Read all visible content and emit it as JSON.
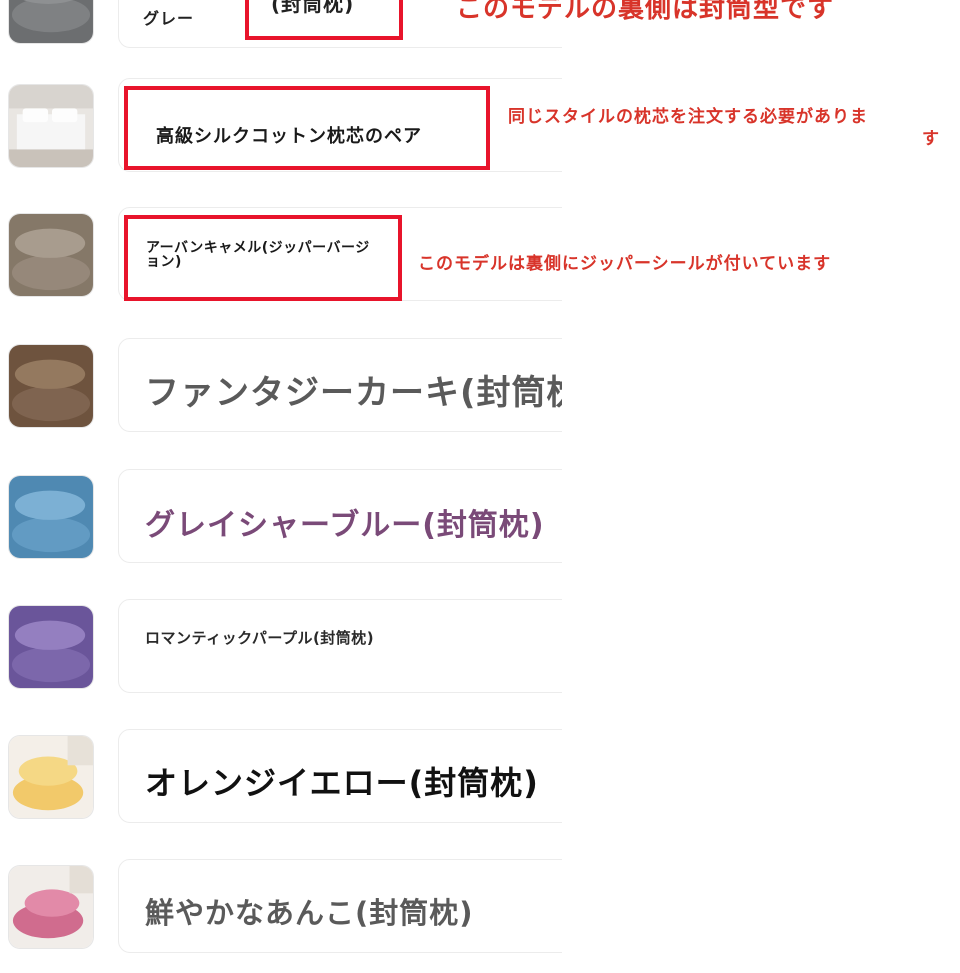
{
  "options": [
    {
      "label": "グレー"
    },
    {
      "label": "高級シルクコットン枕芯のペア"
    },
    {
      "label": "アーバンキャメル(ジッパーバージョン)"
    },
    {
      "label": "ファンタジーカーキ(封筒枕)"
    },
    {
      "label": "グレイシャーブルー(封筒枕)"
    },
    {
      "label": "ロマンティックパープル(封筒枕)"
    },
    {
      "label": "オレンジイエロー(封筒枕)"
    },
    {
      "label": "鮮やかなあんこ(封筒枕)"
    }
  ],
  "top_partial_label": "(封筒枕)",
  "annotations": {
    "top_note": "このモデルの裏側は封筒型です",
    "pillow_core_note_line1": "同じスタイルの枕芯を注文する必要がありま",
    "pillow_core_note_line2": "す",
    "zipper_note": "このモデルは裏側にジッパーシールが付いています"
  },
  "colors": {
    "annotation_red": "#d8342a",
    "highlight_box": "#e8142b",
    "selected_text": "#7a4a78",
    "gray_text": "#5a5a5a",
    "dark_text": "#111111"
  },
  "thumb_icons": [
    "gray-pillow-icon",
    "bed-photo-icon",
    "camel-pillow-icon",
    "khaki-pillow-icon",
    "blue-pillow-icon",
    "purple-pillow-icon",
    "yellow-pillow-icon",
    "pink-pillow-icon"
  ]
}
